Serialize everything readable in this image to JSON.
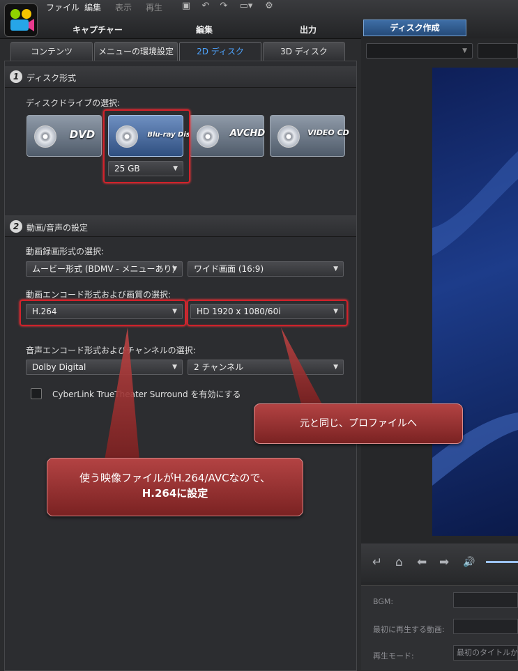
{
  "menubar": {
    "file": "ファイル",
    "edit": "編集",
    "view": "表示",
    "play": "再生"
  },
  "main_tabs": {
    "capture": "キャプチャー",
    "edit": "編集",
    "output": "出力",
    "disc": "ディスク作成"
  },
  "sub_tabs": [
    "コンテンツ",
    "メニューの環境設定",
    "2D ディスク",
    "3D ディスク"
  ],
  "section1": {
    "number": "1",
    "title": "ディスク形式",
    "drive_label": "ディスクドライブの選択:",
    "discs": [
      "DVD",
      "Blu-ray Disc",
      "AVCHD",
      "VIDEO CD"
    ],
    "capacity": "25 GB"
  },
  "section2": {
    "number": "2",
    "title": "動画/音声の設定",
    "record_label": "動画録画形式の選択:",
    "record_format": "ムービー形式 (BDMV - メニューあり)",
    "aspect": "ワイド画面 (16:9)",
    "encode_label": "動画エンコード形式および画質の選択:",
    "video_codec": "H.264",
    "video_profile": "HD 1920 x 1080/60i",
    "audio_label": "音声エンコード形式およびチャンネルの選択:",
    "audio_codec": "Dolby Digital",
    "channels": "2 チャンネル",
    "surround_checkbox": "CyberLink TrueTheater Surround を有効にする"
  },
  "callouts": {
    "profile_note": "元と同じ、プロファイルへ",
    "codec_note_line1": "使う映像ファイルがH.264/AVCなので、",
    "codec_note_line2": "H.264に設定"
  },
  "right": {
    "bgm_label": "BGM:",
    "first_play_label": "最初に再生する動画:",
    "play_mode_label": "再生モード:",
    "play_mode_value": "最初のタイトルから"
  },
  "colors": {
    "highlight": "#d0222b",
    "active_tab_text": "#4ea4ff",
    "callout": "#9a2b2b"
  }
}
